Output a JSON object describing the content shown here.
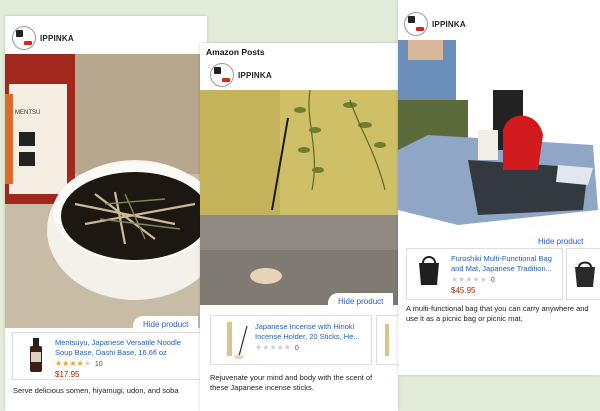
{
  "brand": "IPPINKA",
  "header_label": "Amazon Posts",
  "hide_label": "Hide product",
  "colors": {
    "accent_link": "#1f5fbf",
    "price": "#b12704",
    "background": "#e3ecd9"
  },
  "cards": [
    {
      "product_title": "Mentsuyu, Japanese Versatile Noodle Soup Base, Dashi Base, 16.6fl oz",
      "rating": 4,
      "rating_count": "10",
      "price": "$17.95",
      "description": "Serve delicious somen, hiyamugi, udon, and soba"
    },
    {
      "product_title": "Japanese Incense with Hinoki Incense Holder, 20 Sticks, He...",
      "rating": 0,
      "rating_count": "0",
      "price": "",
      "description": "Rejuvenate your mind and body with the scent of these Japanese incense sticks."
    },
    {
      "product_title": "Furoshiki Multi-Functional Bag and Mat, Japanese Tradition...",
      "rating": 0,
      "rating_count": "0",
      "price": "$45.95",
      "description": "A multi-functional bag that you can carry anywhere and use it as a picnic bag or picnic mat."
    }
  ]
}
